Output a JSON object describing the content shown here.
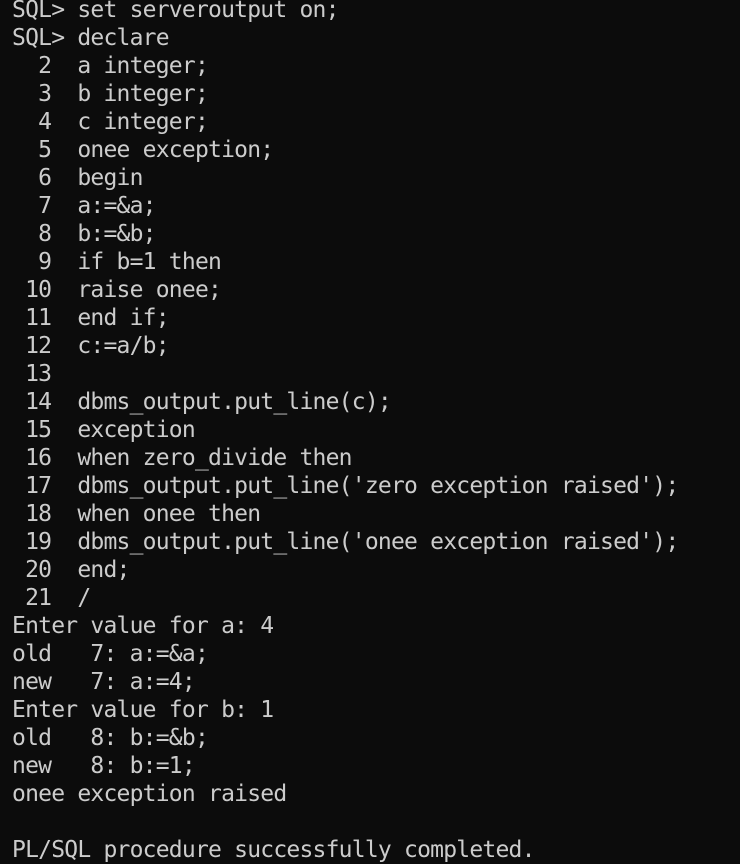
{
  "terminal": {
    "lines": [
      "SQL> set serveroutput on;",
      "SQL> declare",
      "  2  a integer;",
      "  3  b integer;",
      "  4  c integer;",
      "  5  onee exception;",
      "  6  begin",
      "  7  a:=&a;",
      "  8  b:=&b;",
      "  9  if b=1 then",
      " 10  raise onee;",
      " 11  end if;",
      " 12  c:=a/b;",
      " 13",
      " 14  dbms_output.put_line(c);",
      " 15  exception",
      " 16  when zero_divide then",
      " 17  dbms_output.put_line('zero exception raised');",
      " 18  when onee then",
      " 19  dbms_output.put_line('onee exception raised');",
      " 20  end;",
      " 21  /",
      "Enter value for a: 4",
      "old   7: a:=&a;",
      "new   7: a:=4;",
      "Enter value for b: 1",
      "old   8: b:=&b;",
      "new   8: b:=1;",
      "onee exception raised",
      "",
      "PL/SQL procedure successfully completed."
    ]
  }
}
